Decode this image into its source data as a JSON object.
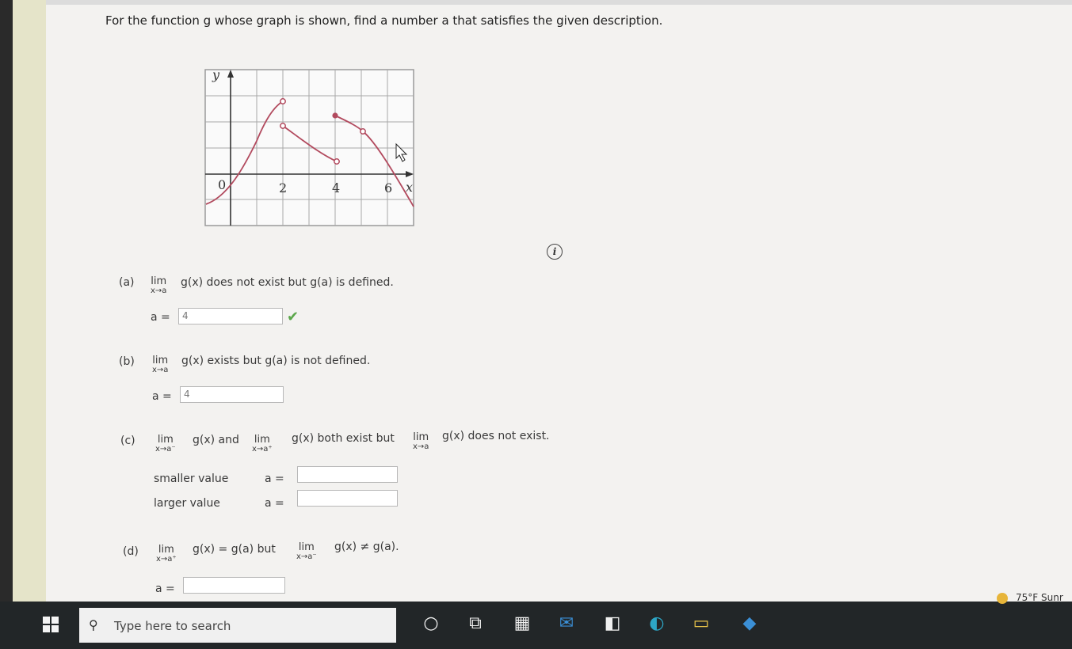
{
  "question": "For the function g whose graph is shown, find a number a that satisfies the given description.",
  "graph": {
    "y_label": "y",
    "x_label": "x",
    "tick_labels": [
      "0",
      "2",
      "4",
      "6"
    ]
  },
  "info_icon": "info-icon",
  "parts": {
    "a": {
      "label": "(a)",
      "lim": "lim",
      "sub": "x→a",
      "desc_1": "g(x) does not exist but g(a) is defined.",
      "a_label": "a =",
      "value": "4",
      "check_icon": "checkmark-icon",
      "check_color": "#5aa64a"
    },
    "b": {
      "label": "(b)",
      "lim": "lim",
      "sub": "x→a",
      "desc_1": "g(x) exists but g(a) is not defined.",
      "a_label": "a =",
      "value": "4"
    },
    "c": {
      "label": "(c)",
      "lim1": "lim",
      "sub1": "x→a⁻",
      "mid": "g(x) and",
      "lim2": "lim",
      "sub2": "x→a⁺",
      "mid2": "g(x) both exist but",
      "lim3": "lim",
      "sub3": "x→a",
      "end": "g(x) does not exist.",
      "smaller_label": "smaller value",
      "larger_label": "larger value",
      "a_label": "a =",
      "smaller_value": "",
      "larger_value": ""
    },
    "d": {
      "label": "(d)",
      "lim1": "lim",
      "sub1": "x→a⁺",
      "mid": "g(x) = g(a) but",
      "lim2": "lim",
      "sub2": "x→a⁻",
      "end": "g(x) ≠ g(a).",
      "a_label": "a =",
      "value": ""
    }
  },
  "taskbar": {
    "search_placeholder": "Type here to search",
    "weather": "75°F Sunr",
    "icons": [
      "windows-start-icon",
      "search-icon",
      "cortana-icon",
      "task-view-icon",
      "calculator-icon",
      "mail-icon",
      "office-icon",
      "edge-icon",
      "file-explorer-icon",
      "app-icon"
    ]
  }
}
